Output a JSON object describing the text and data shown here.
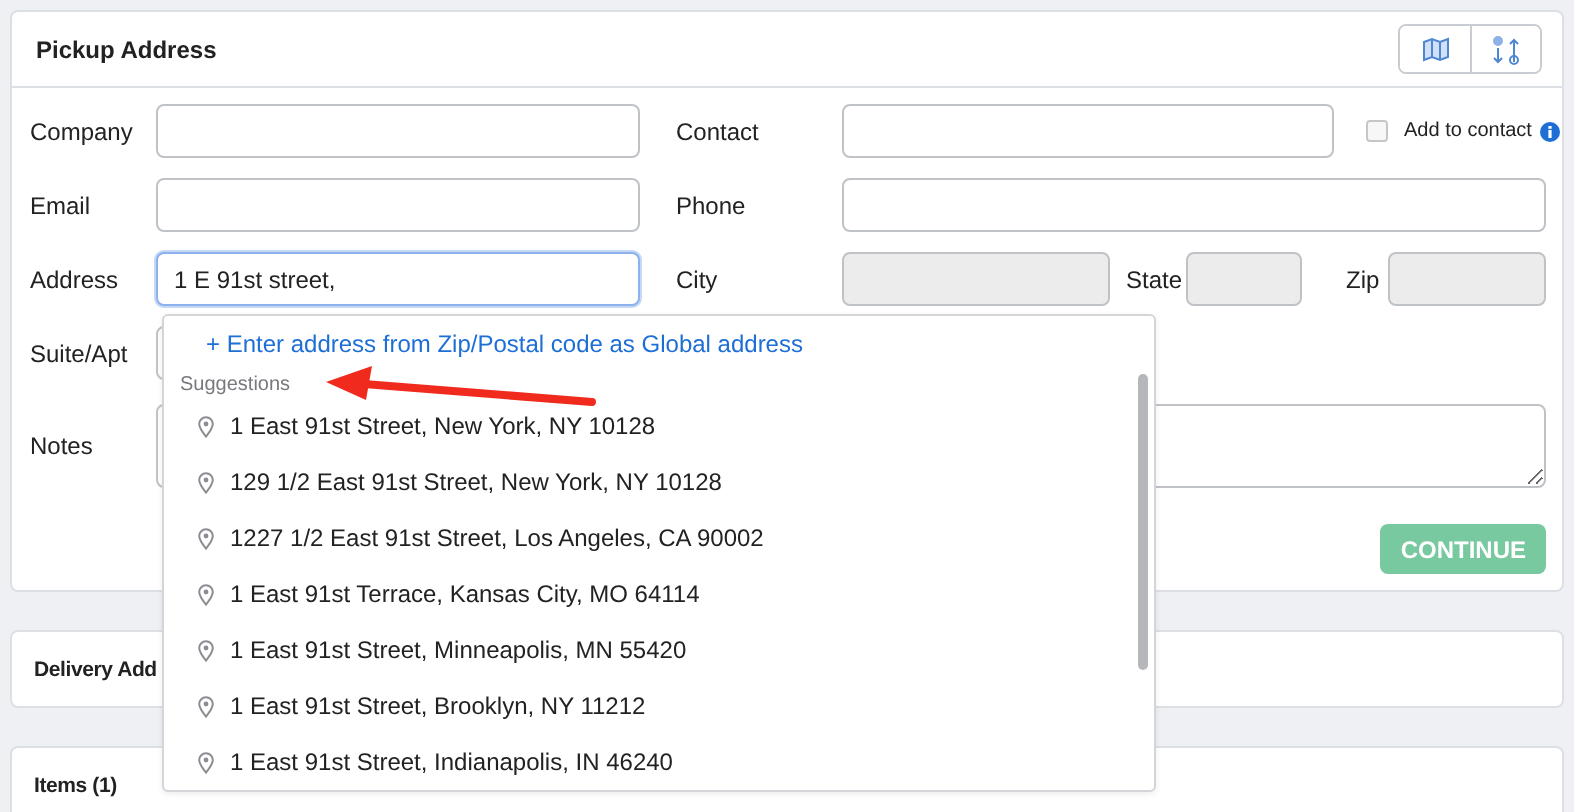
{
  "pickup": {
    "title": "Pickup Address",
    "header_buttons": [
      {
        "kind": "map"
      },
      {
        "kind": "route"
      }
    ],
    "rows": [
      [
        {
          "label": "Company",
          "kind": "text",
          "focused": false,
          "disabled": false
        },
        {
          "label": "Contact",
          "kind": "text",
          "focused": false,
          "disabled": false
        }
      ],
      [
        {
          "label": "Email",
          "kind": "text",
          "focused": false,
          "disabled": false
        },
        {
          "label": "Phone",
          "kind": "text",
          "focused": false,
          "disabled": false
        }
      ],
      [
        {
          "label": "Address",
          "kind": "text",
          "value": "1 E 91st street,",
          "focused": true,
          "disabled": false
        },
        {
          "label": "City",
          "kind": "text",
          "focused": false,
          "disabled": true
        },
        {
          "label": "State",
          "kind": "text",
          "focused": false,
          "disabled": true
        },
        {
          "label": "Zip",
          "kind": "text",
          "focused": false,
          "disabled": true
        }
      ],
      [
        {
          "label": "Suite/Apt",
          "kind": "text",
          "focused": false,
          "disabled": false
        }
      ],
      [
        {
          "label": "Notes",
          "kind": "textarea",
          "focused": false,
          "disabled": false
        }
      ]
    ],
    "add_to_contact": {
      "label": "Add to contact",
      "checked": false
    },
    "continue_button": {
      "label": "CONTINUE",
      "disabled": true
    }
  },
  "dropdown": {
    "link": "+ Enter address from Zip/Postal code as Global address",
    "heading": "Suggestions",
    "items": [
      "1 East 91st Street, New York, NY 10128",
      "129 1/2 East 91st Street, New York, NY 10128",
      "1227 1/2 East 91st Street, Los Angeles, CA 90002",
      "1 East 91st Terrace, Kansas City, MO 64114",
      "1 East 91st Street, Minneapolis, MN 55420",
      "1 East 91st Street, Brooklyn, NY 11212",
      "1 East 91st Street, Indianapolis, IN 46240"
    ]
  },
  "sections": [
    {
      "title": "Delivery Add"
    },
    {
      "title": "Items (1)"
    }
  ]
}
